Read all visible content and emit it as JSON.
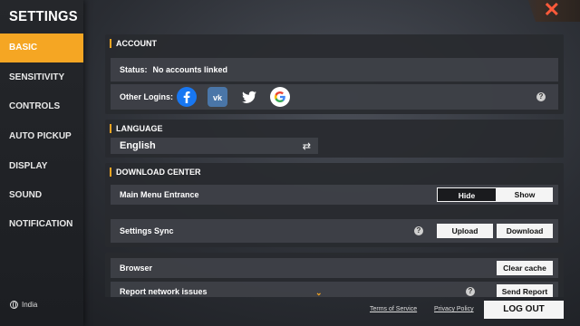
{
  "header": {
    "title": "SETTINGS",
    "close_label": "✕"
  },
  "sidebar": {
    "items": [
      {
        "label": "BASIC"
      },
      {
        "label": "SENSITIVITY"
      },
      {
        "label": "CONTROLS"
      },
      {
        "label": "AUTO PICKUP"
      },
      {
        "label": "DISPLAY"
      },
      {
        "label": "SOUND"
      },
      {
        "label": "NOTIFICATION"
      }
    ],
    "active_index": 0,
    "region": "India"
  },
  "account": {
    "header": "ACCOUNT",
    "status_label": "Status:",
    "status_value": "No accounts linked",
    "other_logins_label": "Other Logins:",
    "logins": [
      "facebook-icon",
      "vk-icon",
      "twitter-icon",
      "google-icon"
    ],
    "help": "?"
  },
  "language": {
    "header": "LANGUAGE",
    "selected": "English",
    "swap_icon": "⇄"
  },
  "download_center": {
    "header": "DOWNLOAD CENTER",
    "main_menu_label": "Main Menu Entrance",
    "hide_label": "Hide",
    "show_label": "Show",
    "selected": "Show",
    "sync_label": "Settings Sync",
    "upload_label": "Upload",
    "download_label": "Download",
    "help": "?"
  },
  "misc": {
    "browser_label": "Browser",
    "clear_cache_label": "Clear cache",
    "report_label": "Report network issues",
    "send_report_label": "Send Report",
    "help": "?",
    "scroll_icon": "⌄"
  },
  "footer": {
    "terms": "Terms of Service",
    "privacy": "Privacy Policy",
    "logout": "LOG OUT"
  },
  "colors": {
    "accent": "#f5a623",
    "close": "#ff5a3a"
  }
}
